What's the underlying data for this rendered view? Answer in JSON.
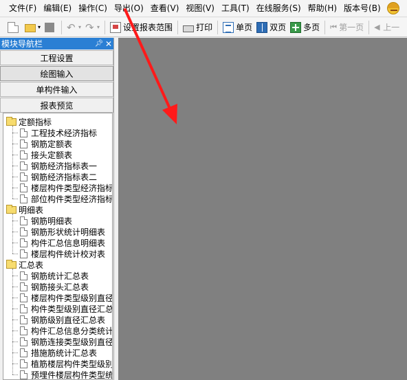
{
  "menubar": {
    "items": [
      "文件(F)",
      "编辑(E)",
      "操作(C)",
      "导出(O)",
      "查看(V)",
      "视图(V)",
      "工具(T)",
      "在线服务(S)",
      "帮助(H)",
      "版本号(B)"
    ]
  },
  "toolbar": {
    "setup_report_label": "设置报表范围",
    "print_label": "打印",
    "single_page_label": "单页",
    "double_page_label": "双页",
    "multi_page_label": "多页",
    "first_page_label": "第一页",
    "prev_page_label": "上一"
  },
  "nav": {
    "title": "模块导航栏",
    "buttons": [
      "工程设置",
      "绘图输入",
      "单构件输入",
      "报表预览"
    ],
    "tree": [
      {
        "type": "folder",
        "label": "定额指标"
      },
      {
        "type": "doc",
        "label": "工程技术经济指标"
      },
      {
        "type": "doc",
        "label": "钢筋定额表"
      },
      {
        "type": "doc",
        "label": "接头定额表"
      },
      {
        "type": "doc",
        "label": "钢筋经济指标表一"
      },
      {
        "type": "doc",
        "label": "钢筋经济指标表二"
      },
      {
        "type": "doc",
        "label": "楼层构件类型经济指标"
      },
      {
        "type": "doc",
        "label": "部位构件类型经济指标"
      },
      {
        "type": "folder",
        "label": "明细表"
      },
      {
        "type": "doc",
        "label": "钢筋明细表"
      },
      {
        "type": "doc",
        "label": "钢筋形状统计明细表"
      },
      {
        "type": "doc",
        "label": "构件汇总信息明细表"
      },
      {
        "type": "doc",
        "label": "楼层构件统计校对表"
      },
      {
        "type": "folder",
        "label": "汇总表"
      },
      {
        "type": "doc",
        "label": "钢筋统计汇总表"
      },
      {
        "type": "doc",
        "label": "钢筋接头汇总表"
      },
      {
        "type": "doc",
        "label": "楼层构件类型级别直径汇总表"
      },
      {
        "type": "doc",
        "label": "构件类型级别直径汇总表"
      },
      {
        "type": "doc",
        "label": "钢筋级别直径汇总表"
      },
      {
        "type": "doc",
        "label": "构件汇总信息分类统计表"
      },
      {
        "type": "doc",
        "label": "钢筋连接类型级别直径汇总表"
      },
      {
        "type": "doc",
        "label": "措施筋统计汇总表"
      },
      {
        "type": "doc",
        "label": "植筋楼层构件类型级别直径汇总表"
      },
      {
        "type": "doc",
        "label": "预埋件楼层构件类型统计表"
      }
    ]
  },
  "colors": {
    "nav_title_bg": "#2a7fd4",
    "main_bg": "#808080",
    "arrow": "#ff1a1a"
  }
}
